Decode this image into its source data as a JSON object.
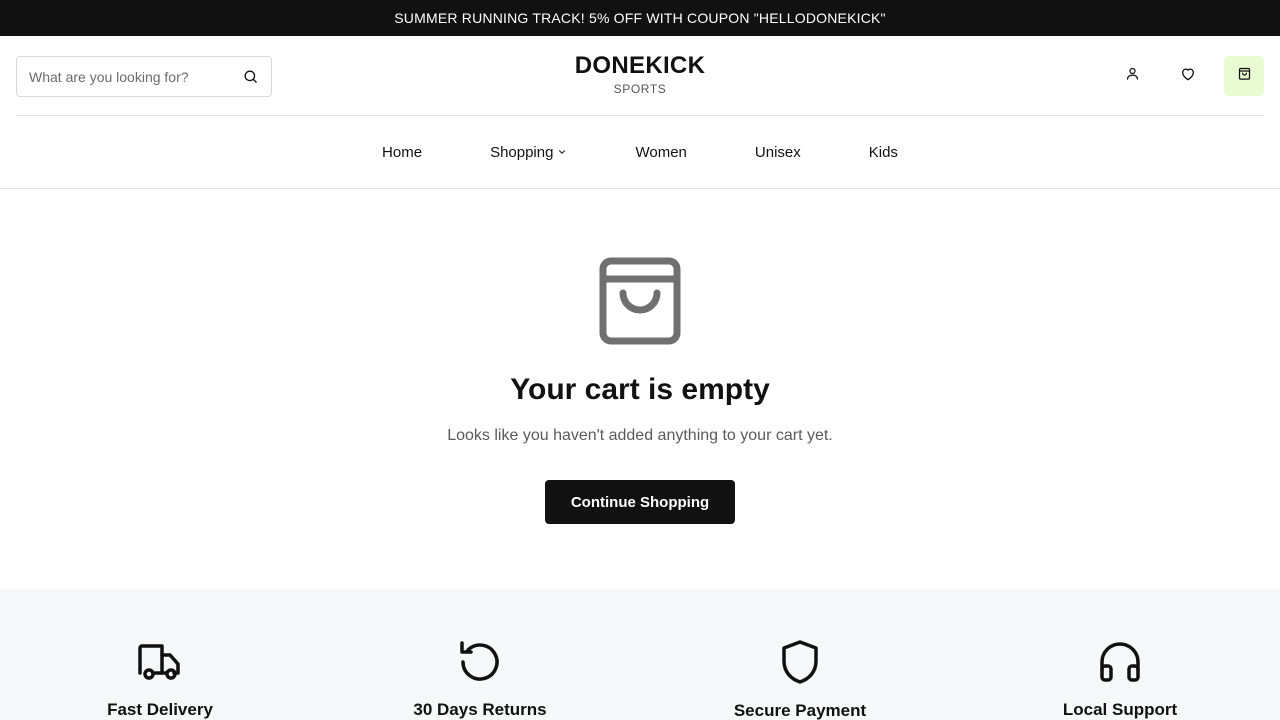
{
  "announcement": "SUMMER RUNNING TRACK! 5% OFF WITH COUPON \"HELLODONEKICK\"",
  "search": {
    "placeholder": "What are you looking for?",
    "icon": "search-icon"
  },
  "logo": {
    "brand": "DONEKICK",
    "sub": "SPORTS"
  },
  "header_actions": [
    {
      "icon": "user-icon"
    },
    {
      "icon": "heart-icon"
    },
    {
      "icon": "cart-bag-icon",
      "highlight_color": "#e9fbd3"
    }
  ],
  "nav": [
    {
      "label": "Home"
    },
    {
      "label": "Shopping",
      "has_dropdown": true
    },
    {
      "label": "Women"
    },
    {
      "label": "Unisex"
    },
    {
      "label": "Kids"
    }
  ],
  "empty_cart": {
    "icon": "shopping-bag-icon",
    "title": "Your cart is empty",
    "message": "Looks like you haven't added anything to your cart yet.",
    "button": "Continue Shopping"
  },
  "features": [
    {
      "icon": "truck-icon",
      "title": "Fast Delivery"
    },
    {
      "icon": "rotate-icon",
      "title": "30 Days Returns"
    },
    {
      "icon": "shield-icon",
      "title": "Secure Payment"
    },
    {
      "icon": "headphones-icon",
      "title": "Local Support"
    }
  ],
  "colors": {
    "announcement_bg": "#111111",
    "accent_cart_bg": "#e9fbd3",
    "button_bg": "#111111",
    "features_bg": "#f7f8fa"
  }
}
